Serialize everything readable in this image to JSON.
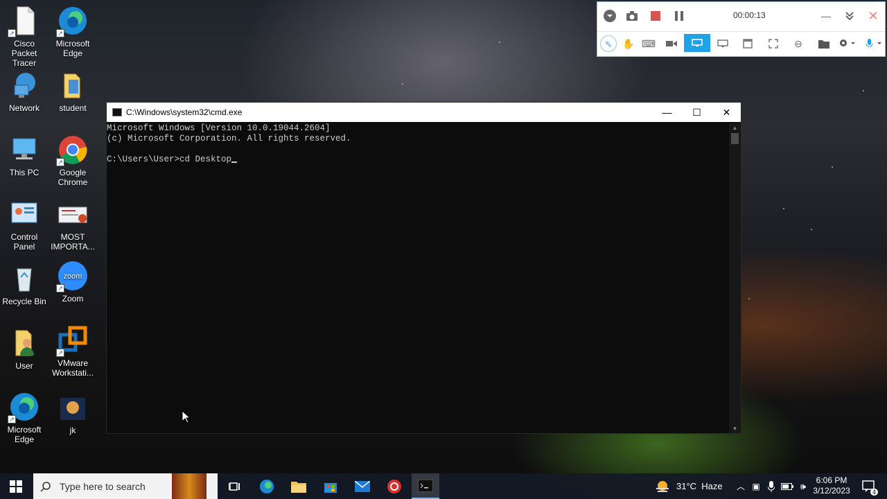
{
  "desktop": {
    "icons": [
      {
        "label": "Cisco Packet Tracer",
        "icon": "document-icon"
      },
      {
        "label": "Microsoft Edge",
        "icon": "edge-icon"
      },
      {
        "label": "Network",
        "icon": "network-icon"
      },
      {
        "label": "student",
        "icon": "folder-icon"
      },
      {
        "label": "This PC",
        "icon": "pc-icon"
      },
      {
        "label": "Google Chrome",
        "icon": "chrome-icon"
      },
      {
        "label": "Control Panel",
        "icon": "control-panel-icon"
      },
      {
        "label": "MOST IMPORTA...",
        "icon": "powerpoint-icon"
      },
      {
        "label": "Recycle Bin",
        "icon": "recycle-bin-icon"
      },
      {
        "label": "Zoom",
        "icon": "zoom-icon"
      },
      {
        "label": "User",
        "icon": "user-folder-icon"
      },
      {
        "label": "VMware Workstati...",
        "icon": "vmware-icon"
      },
      {
        "label": "Microsoft Edge",
        "icon": "edge-icon"
      },
      {
        "label": "jk",
        "icon": "image-icon"
      }
    ]
  },
  "recorder": {
    "timer": "00:00:13",
    "colors": {
      "accent": "#1fa3e6",
      "stop": "#d9534f"
    }
  },
  "cmd": {
    "title": "C:\\Windows\\system32\\cmd.exe",
    "lines": [
      "Microsoft Windows [Version 10.0.19044.2604]",
      "(c) Microsoft Corporation. All rights reserved.",
      "",
      "C:\\Users\\User>cd Desktop"
    ]
  },
  "taskbar": {
    "search_placeholder": "Type here to search",
    "weather": "31°C  Haze",
    "time": "6:06 PM",
    "date": "3/12/2023",
    "notifications": "4"
  }
}
